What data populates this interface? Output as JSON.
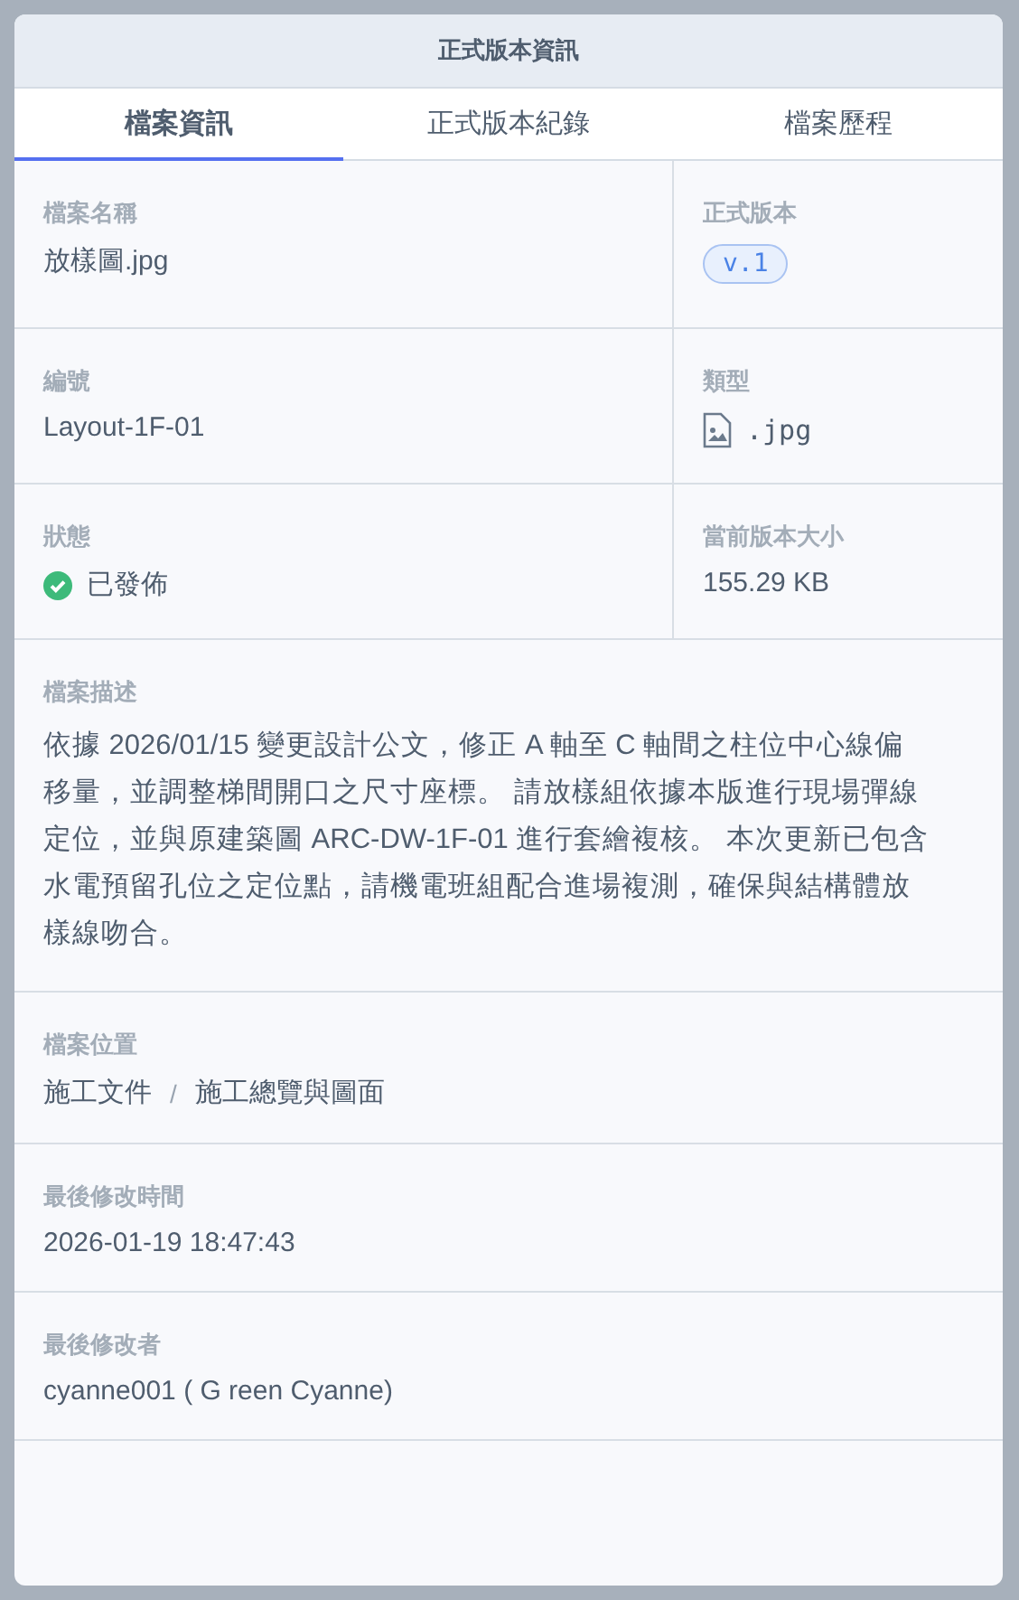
{
  "dialog": {
    "title": "正式版本資訊"
  },
  "tabs": [
    {
      "label": "檔案資訊",
      "selected": true
    },
    {
      "label": "正式版本紀錄",
      "selected": false
    },
    {
      "label": "檔案歷程",
      "selected": false
    }
  ],
  "grid": [
    {
      "left": {
        "label": "檔案名稱",
        "value": "放樣圖.jpg"
      },
      "right": {
        "label": "正式版本",
        "kind": "badge",
        "value": "v.1"
      }
    },
    {
      "left": {
        "label": "編號",
        "value": "Layout-1F-01"
      },
      "right": {
        "label": "類型",
        "kind": "filetype",
        "value": ".jpg"
      }
    },
    {
      "left": {
        "label": "狀態",
        "kind": "status",
        "published": true,
        "value": "已發佈"
      },
      "right": {
        "label": "當前版本大小",
        "value": "155.29 KB"
      }
    }
  ],
  "description": {
    "label": "檔案描述",
    "text": "依據 2026/01/15 變更設計公文，修正 A 軸至 C 軸間之柱位中心線偏移量，並調整梯間開口之尺寸座標。 請放樣組依據本版進行現場彈線定位，並與原建築圖 ARC-DW-1F-01 進行套繪複核。 本次更新已包含水電預留孔位之定位點，請機電班組配合進場複測，確保與結構體放樣線吻合。"
  },
  "location": {
    "label": "檔案位置",
    "path": [
      "施工文件",
      "/",
      "施工總覽與圖面"
    ]
  },
  "modified_time": {
    "label": "最後修改時間",
    "value": "2026-01-19 18:47:43"
  },
  "modified_by": {
    "label": "最後修改者",
    "value": "cyanne001 ( G reen Cyanne)"
  }
}
